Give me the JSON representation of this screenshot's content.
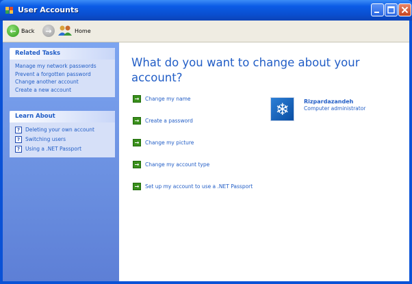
{
  "window": {
    "title": "User Accounts",
    "controls": [
      "minimize",
      "maximize",
      "close"
    ]
  },
  "toolbar": {
    "back_label": "Back",
    "home_label": "Home"
  },
  "sidebar": {
    "related_tasks": {
      "title": "Related Tasks",
      "items": [
        "Manage my network passwords",
        "Prevent a forgotten password",
        "Change another account",
        "Create a new account"
      ]
    },
    "learn_about": {
      "title": "Learn About",
      "items": [
        "Deleting your own account",
        "Switching users",
        "Using a .NET Passport"
      ]
    }
  },
  "main": {
    "heading": "What do you want to change about your account?",
    "actions": [
      "Change my name",
      "Create a password",
      "Change my picture",
      "Change my account type",
      "Set up my account to use a .NET Passport"
    ],
    "user": {
      "name": "Rizpardazandeh",
      "role": "Computer administrator"
    }
  },
  "colors": {
    "title_bar": "#0a52d6",
    "sidebar": "#6a8fe0",
    "link": "#215dc6",
    "action_arrow": "#3a8f1c"
  }
}
